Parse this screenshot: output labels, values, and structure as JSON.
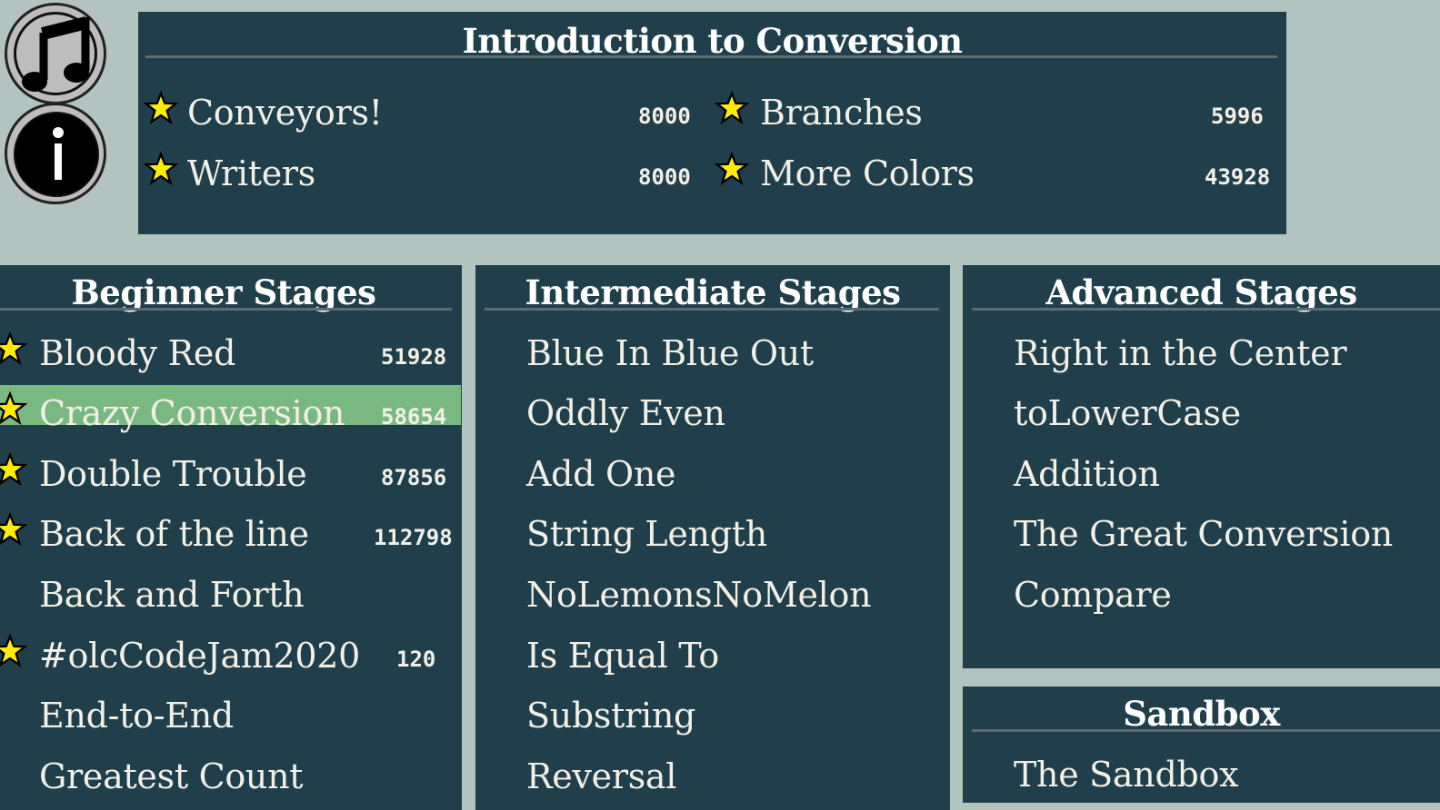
{
  "colors": {
    "background": "#b3c3bf",
    "panel": "#213f4a",
    "selected_row": "#7ab882",
    "star": "#ffec00",
    "text": "#f2f0e6"
  },
  "buttons": {
    "music_icon": "music-note-icon",
    "info_icon": "info-icon"
  },
  "intro": {
    "title": "Introduction to Conversion",
    "levels": [
      {
        "name": "Conveyors!",
        "score": "8000",
        "starred": true
      },
      {
        "name": "Writers",
        "score": "8000",
        "starred": true
      },
      {
        "name": "Branches",
        "score": "5996",
        "starred": true
      },
      {
        "name": "More Colors",
        "score": "43928",
        "starred": true
      }
    ]
  },
  "beginner": {
    "title": "Beginner Stages",
    "levels": [
      {
        "name": "Bloody Red",
        "score": "51928",
        "starred": true
      },
      {
        "name": "Crazy Conversion",
        "score": "58654",
        "starred": true,
        "selected": true
      },
      {
        "name": "Double Trouble",
        "score": "87856",
        "starred": true
      },
      {
        "name": "Back of the line",
        "score": "112798",
        "starred": true
      },
      {
        "name": "Back and Forth",
        "score": "",
        "starred": false
      },
      {
        "name": "#olcCodeJam2020",
        "score": "120",
        "starred": true
      },
      {
        "name": "End-to-End",
        "score": "",
        "starred": false
      },
      {
        "name": "Greatest Count",
        "score": "",
        "starred": false
      }
    ]
  },
  "intermediate": {
    "title": "Intermediate Stages",
    "levels": [
      {
        "name": "Blue In Blue Out"
      },
      {
        "name": "Oddly Even"
      },
      {
        "name": "Add One"
      },
      {
        "name": "String Length"
      },
      {
        "name": "NoLemonsNoMelon"
      },
      {
        "name": "Is Equal To"
      },
      {
        "name": "Substring"
      },
      {
        "name": "Reversal"
      }
    ]
  },
  "advanced": {
    "title": "Advanced Stages",
    "levels": [
      {
        "name": "Right in the Center"
      },
      {
        "name": "toLowerCase"
      },
      {
        "name": "Addition"
      },
      {
        "name": "The Great Conversion"
      },
      {
        "name": "Compare"
      }
    ]
  },
  "sandbox": {
    "title": "Sandbox",
    "levels": [
      {
        "name": "The Sandbox"
      }
    ]
  }
}
